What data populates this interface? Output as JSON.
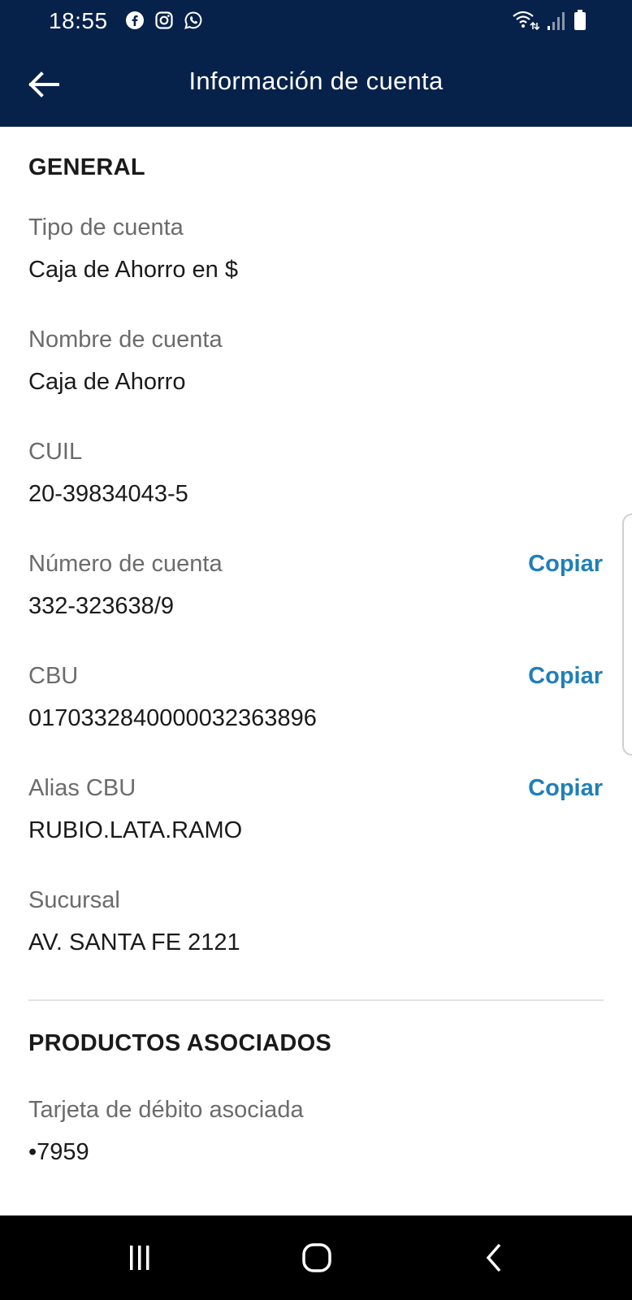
{
  "status_bar": {
    "time": "18:55",
    "apps": [
      "facebook-icon",
      "instagram-icon",
      "whatsapp-icon"
    ]
  },
  "header": {
    "title": "Información de cuenta",
    "back_icon": "arrow-left-icon"
  },
  "general": {
    "section_title": "GENERAL",
    "fields": [
      {
        "label": "Tipo de cuenta",
        "value": "Caja de Ahorro en $"
      },
      {
        "label": "Nombre de cuenta",
        "value": "Caja de Ahorro"
      },
      {
        "label": "CUIL",
        "value": "20-39834043-5"
      },
      {
        "label": "Número de cuenta",
        "value": "332-323638/9",
        "action": "Copiar"
      },
      {
        "label": "CBU",
        "value": "0170332840000032363896",
        "action": "Copiar"
      },
      {
        "label": "Alias CBU",
        "value": "RUBIO.LATA.RAMO",
        "action": "Copiar"
      },
      {
        "label": "Sucursal",
        "value": "AV. SANTA FE 2121"
      }
    ]
  },
  "products": {
    "section_title": "PRODUCTOS ASOCIADOS",
    "fields": [
      {
        "label": "Tarjeta de débito asociada",
        "value": "•7959"
      }
    ]
  },
  "colors": {
    "header_bg": "#07224a",
    "accent": "#1f7fb8",
    "label": "#6b6b6b",
    "text": "#1a1a1a"
  }
}
